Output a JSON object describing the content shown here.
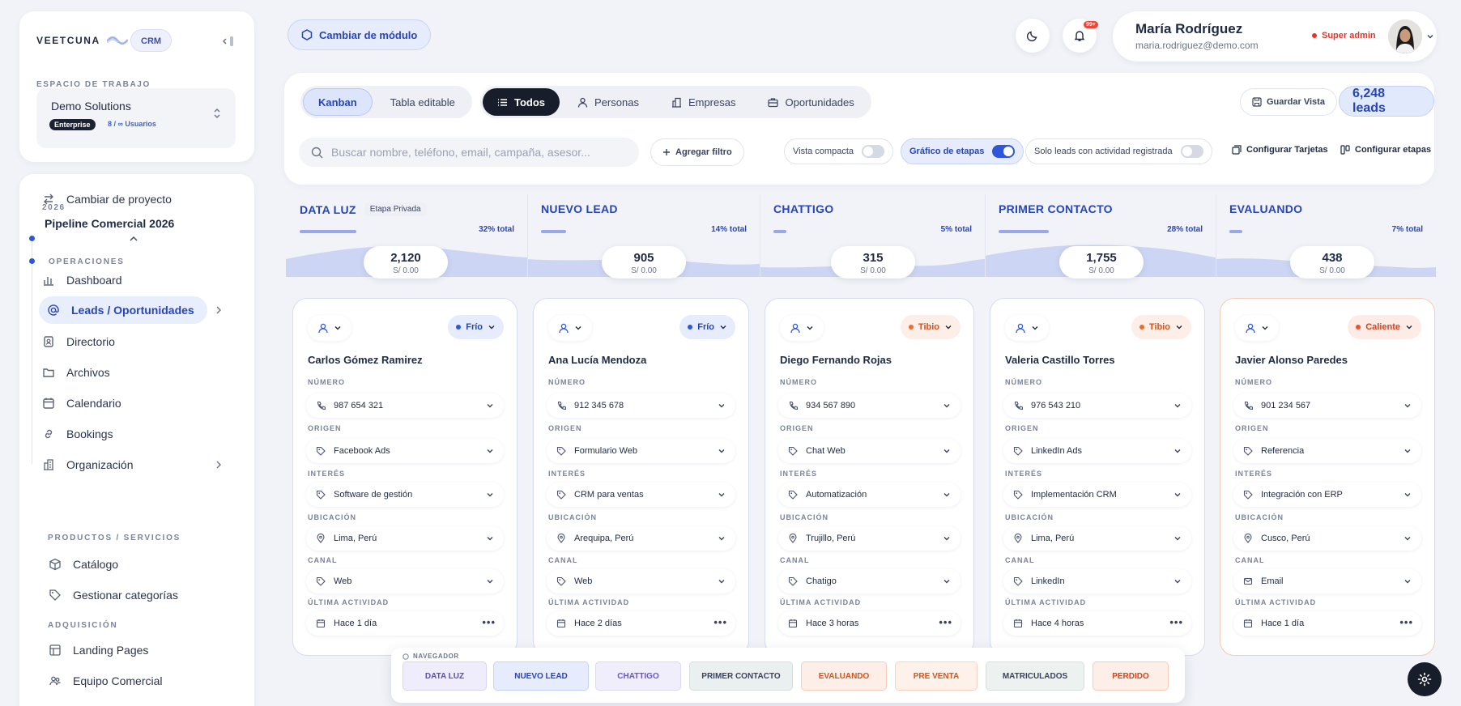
{
  "brand": {
    "name": "VEETCUNA",
    "module_chip": "CRM"
  },
  "workspace": {
    "label": "ESPACIO DE TRABAJO",
    "name": "Demo Solutions",
    "plan": "Enterprise",
    "users": "8 / ∞ Usuarios"
  },
  "sidebar": {
    "change_project": "Cambiar de proyecto",
    "project_year": "2026",
    "project_name": "Pipeline Comercial 2026",
    "sections": {
      "ops": "OPERACIONES",
      "products": "PRODUCTOS / SERVICIOS",
      "acquisition": "ADQUISICIÓN"
    },
    "items": [
      {
        "label": "Dashboard",
        "icon": "bar-chart-icon"
      },
      {
        "label": "Leads / Oportunidades",
        "icon": "at-sign-icon"
      },
      {
        "label": "Directorio",
        "icon": "address-book-icon"
      },
      {
        "label": "Archivos",
        "icon": "folder-icon"
      },
      {
        "label": "Calendario",
        "icon": "calendar-icon"
      },
      {
        "label": "Bookings",
        "icon": "link-icon"
      },
      {
        "label": "Organización",
        "icon": "building-icon"
      },
      {
        "label": "Catálogo",
        "icon": "box-icon"
      },
      {
        "label": "Gestionar categorías",
        "icon": "tag-icon"
      },
      {
        "label": "Landing Pages",
        "icon": "layout-icon"
      },
      {
        "label": "Equipo Comercial",
        "icon": "users-icon"
      }
    ]
  },
  "header": {
    "module_button": "Cambiar de módulo",
    "notif_count": "99+",
    "user_name": "María Rodríguez",
    "user_email": "maria.rodriguez@demo.com",
    "role": "Super admin"
  },
  "toolbar": {
    "views": [
      "Kanban",
      "Tabla editable"
    ],
    "filters": [
      "Todos",
      "Personas",
      "Empresas",
      "Oportunidades"
    ],
    "save_view": "Guardar Vista",
    "leads_count": "6,248 leads",
    "search_placeholder": "Buscar nombre, teléfono, email, campaña, asesor...",
    "add_filter": "Agregar filtro",
    "toggles": [
      {
        "label": "Vista compacta",
        "on": false
      },
      {
        "label": "Gráfico de etapas",
        "on": true
      },
      {
        "label": "Solo leads con actividad registrada",
        "on": false
      }
    ],
    "config_cards": "Configurar Tarjetas",
    "config_stages": "Configurar etapas"
  },
  "stages": [
    {
      "name": "DATA LUZ",
      "tag": "Etapa Privada",
      "pct": "32% total",
      "count": "2,120",
      "amount": "S/ 0.00",
      "bar": 0.32
    },
    {
      "name": "NUEVO LEAD",
      "tag": "",
      "pct": "14% total",
      "count": "905",
      "amount": "S/ 0.00",
      "bar": 0.14
    },
    {
      "name": "CHATTIGO",
      "tag": "",
      "pct": "5% total",
      "count": "315",
      "amount": "S/ 0.00",
      "bar": 0.05
    },
    {
      "name": "PRIMER CONTACTO",
      "tag": "",
      "pct": "28% total",
      "count": "1,755",
      "amount": "S/ 0.00",
      "bar": 0.28
    },
    {
      "name": "EVALUANDO",
      "tag": "",
      "pct": "7% total",
      "count": "438",
      "amount": "S/ 0.00",
      "bar": 0.07
    }
  ],
  "field_labels": {
    "numero": "NÚMERO",
    "origen": "ORIGEN",
    "interes": "INTERÉS",
    "ubicacion": "UBICACIÓN",
    "canal": "CANAL",
    "ultima": "ÚLTIMA ACTIVIDAD"
  },
  "cards": [
    {
      "temp": "Frío",
      "temp_class": "frio",
      "name": "Carlos Gómez Ramirez",
      "numero": "987 654 321",
      "origen": "Facebook Ads",
      "interes": "Software de gestión",
      "ubicacion": "Lima, Perú",
      "canal": "Web",
      "ultima": "Hace 1 día"
    },
    {
      "temp": "Frío",
      "temp_class": "frio",
      "name": "Ana Lucía Mendoza",
      "numero": "912 345 678",
      "origen": "Formulario Web",
      "interes": "CRM para ventas",
      "ubicacion": "Arequipa, Perú",
      "canal": "Web",
      "ultima": "Hace 2 días"
    },
    {
      "temp": "Tibio",
      "temp_class": "tibio",
      "name": "Diego Fernando Rojas",
      "numero": "934 567 890",
      "origen": "Chat Web",
      "interes": "Automatización",
      "ubicacion": "Trujillo, Perú",
      "canal": "Chatigo",
      "ultima": "Hace 3 horas"
    },
    {
      "temp": "Tibio",
      "temp_class": "tibio",
      "name": "Valeria Castillo Torres",
      "numero": "976 543 210",
      "origen": "LinkedIn Ads",
      "interes": "Implementación CRM",
      "ubicacion": "Lima, Perú",
      "canal": "LinkedIn",
      "ultima": "Hace 4 horas"
    },
    {
      "temp": "Caliente",
      "temp_class": "caliente",
      "name": "Javier Alonso Paredes",
      "numero": "901 234 567",
      "origen": "Referencia",
      "interes": "Integración con ERP",
      "ubicacion": "Cusco, Perú",
      "canal": "Email",
      "ultima": "Hace 1 día"
    }
  ],
  "navigator": {
    "label": "NAVEGADOR",
    "chips": [
      {
        "label": "DATA LUZ",
        "color": "#5a4fb8",
        "bg": "#efedfb",
        "border": "#d9d4f3"
      },
      {
        "label": "NUEVO LEAD",
        "color": "#2745b8",
        "bg": "#e6ecfb",
        "border": "#c3d2f6"
      },
      {
        "label": "CHATTIGO",
        "color": "#6a55c9",
        "bg": "#f1eefc",
        "border": "#ddd6f5"
      },
      {
        "label": "PRIMER CONTACTO",
        "color": "#3a4360",
        "bg": "#eaf0ef",
        "border": "#d5dfdc"
      },
      {
        "label": "EVALUANDO",
        "color": "#d8531b",
        "bg": "#fdeee7",
        "border": "#f6cbb7"
      },
      {
        "label": "PRE VENTA",
        "color": "#d8531b",
        "bg": "#fdf1ea",
        "border": "#f7d3bf"
      },
      {
        "label": "MATRICULADOS",
        "color": "#3a4360",
        "bg": "#edf1f0",
        "border": "#d5dfdc"
      },
      {
        "label": "PERDIDO",
        "color": "#d8411b",
        "bg": "#fdeee7",
        "border": "#f6cbb7"
      }
    ]
  }
}
